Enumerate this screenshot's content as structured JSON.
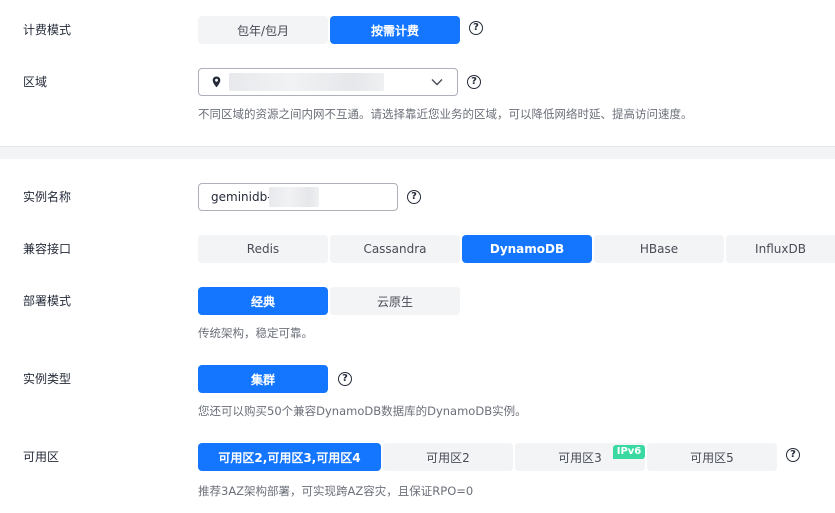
{
  "billing": {
    "label": "计费模式",
    "options": [
      "包年/包月",
      "按需计费"
    ],
    "selected": 1
  },
  "region": {
    "label": "区域",
    "hint": "不同区域的资源之间内网不互通。请选择靠近您业务的区域，可以降低网络时延、提高访问速度。"
  },
  "instance_name": {
    "label": "实例名称",
    "value": "geminidb-"
  },
  "compat": {
    "label": "兼容接口",
    "options": [
      "Redis",
      "Cassandra",
      "DynamoDB",
      "HBase",
      "InfluxDB"
    ],
    "selected": 2
  },
  "deploy": {
    "label": "部署模式",
    "options": [
      "经典",
      "云原生"
    ],
    "selected": 0,
    "hint": "传统架构，稳定可靠。"
  },
  "instance_type": {
    "label": "实例类型",
    "options": [
      "集群"
    ],
    "selected": 0,
    "hint": "您还可以购买50个兼容DynamoDB数据库的DynamoDB实例。"
  },
  "az": {
    "label": "可用区",
    "options": [
      "可用区2,可用区3,可用区4",
      "可用区2",
      "可用区3",
      "可用区5"
    ],
    "selected": 0,
    "badge": "IPv6",
    "hint": "推荐3AZ架构部署，可实现跨AZ容灾，且保证RPO=0"
  },
  "help_glyph": "?",
  "colors": {
    "accent": "#1476ff",
    "badge": "#3bd9a2",
    "segment_bg": "#f3f4f6"
  }
}
